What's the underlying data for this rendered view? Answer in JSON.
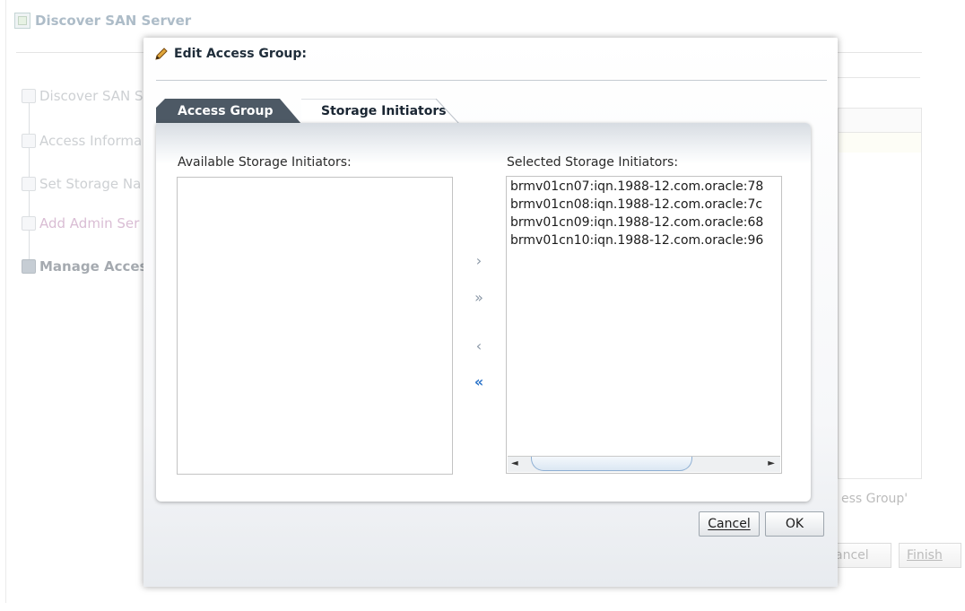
{
  "background": {
    "title": "Discover SAN Server",
    "steps": [
      {
        "label": "Discover SAN S",
        "state": "normal"
      },
      {
        "label": "Access Informa",
        "state": "normal"
      },
      {
        "label": "Set Storage Na",
        "state": "normal"
      },
      {
        "label": "Add Admin Ser",
        "state": "visited"
      },
      {
        "label": "Manage Acces",
        "state": "active"
      }
    ],
    "hint_text": "ess Group'",
    "cancel_label": "Cancel",
    "cancel_visible": "ancel",
    "finish_label": "Finish"
  },
  "dialog": {
    "title": "Edit Access Group:",
    "tabs": [
      {
        "label": "Access Group",
        "selected": false
      },
      {
        "label": "Storage Initiators",
        "selected": true
      }
    ],
    "available_label": "Available Storage Initiators:",
    "selected_label": "Selected Storage Initiators:",
    "available_items": [],
    "selected_items": [
      "brmv01cn07:iqn.1988-12.com.oracle:78",
      "brmv01cn08:iqn.1988-12.com.oracle:7c",
      "brmv01cn09:iqn.1988-12.com.oracle:68",
      "brmv01cn10:iqn.1988-12.com.oracle:96"
    ],
    "shuttle": {
      "move": "›",
      "move_all": "»",
      "remove": "‹",
      "remove_all": "«"
    },
    "cancel_label": "Cancel",
    "ok_label": "OK"
  },
  "colors": {
    "tab_active_underline": "#d92b2b",
    "tab_inactive_bg": "#4d5965",
    "link_blue": "#2a73c9"
  },
  "icons": {
    "title_icon": "pencil-icon",
    "bg_title_icon": "wizard-icon"
  }
}
